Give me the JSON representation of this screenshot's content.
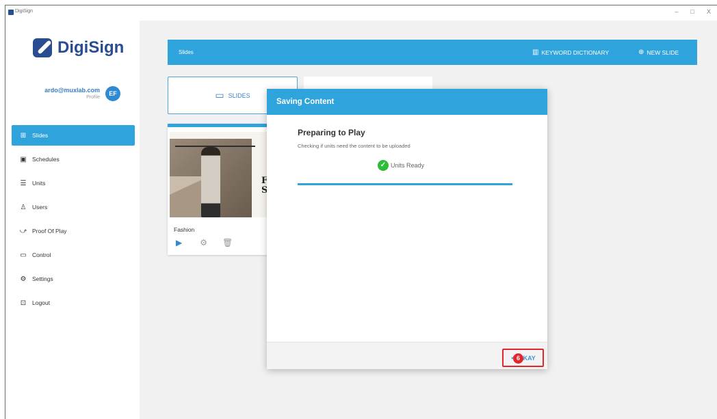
{
  "window": {
    "title": "DigiSign",
    "minimize": "–",
    "maximize": "□",
    "close": "X"
  },
  "sidebar": {
    "logo_text": "DigiSign",
    "user_email": "ardo@muxlab.com",
    "profile_label": "Profile",
    "avatar_initials": "EF",
    "items": [
      {
        "label": "Slides",
        "icon": "grid-icon",
        "glyph": "⊞",
        "active": true
      },
      {
        "label": "Schedules",
        "icon": "calendar-icon",
        "glyph": "▣"
      },
      {
        "label": "Units",
        "icon": "server-icon",
        "glyph": "☰"
      },
      {
        "label": "Users",
        "icon": "user-icon",
        "glyph": "♙"
      },
      {
        "label": "Proof Of Play",
        "icon": "chart-line-icon",
        "glyph": "⤻"
      },
      {
        "label": "Control",
        "icon": "monitor-icon",
        "glyph": "▭"
      },
      {
        "label": "Settings",
        "icon": "gear-icon",
        "glyph": "⚙"
      },
      {
        "label": "Logout",
        "icon": "logout-icon",
        "glyph": "⊡"
      }
    ]
  },
  "topbar": {
    "title": "Slides",
    "keyword_dictionary": "KEYWORD DICTIONARY",
    "new_slide": "NEW SLIDE"
  },
  "tabs": {
    "slides_label": "SLIDES"
  },
  "card": {
    "name": "Fashion",
    "thumb_letters": "F\nS"
  },
  "dialog": {
    "title": "Saving Content",
    "heading": "Preparing to Play",
    "subtext": "Checking if units need the content to be uploaded",
    "status_text": "Units Ready",
    "progress": 1.0,
    "okay_label": "OKAY",
    "step_badge": "6"
  },
  "colors": {
    "accent": "#2fa4dc",
    "brand": "#2a4c91",
    "success": "#2ebd3b",
    "highlight": "#e2262b"
  }
}
